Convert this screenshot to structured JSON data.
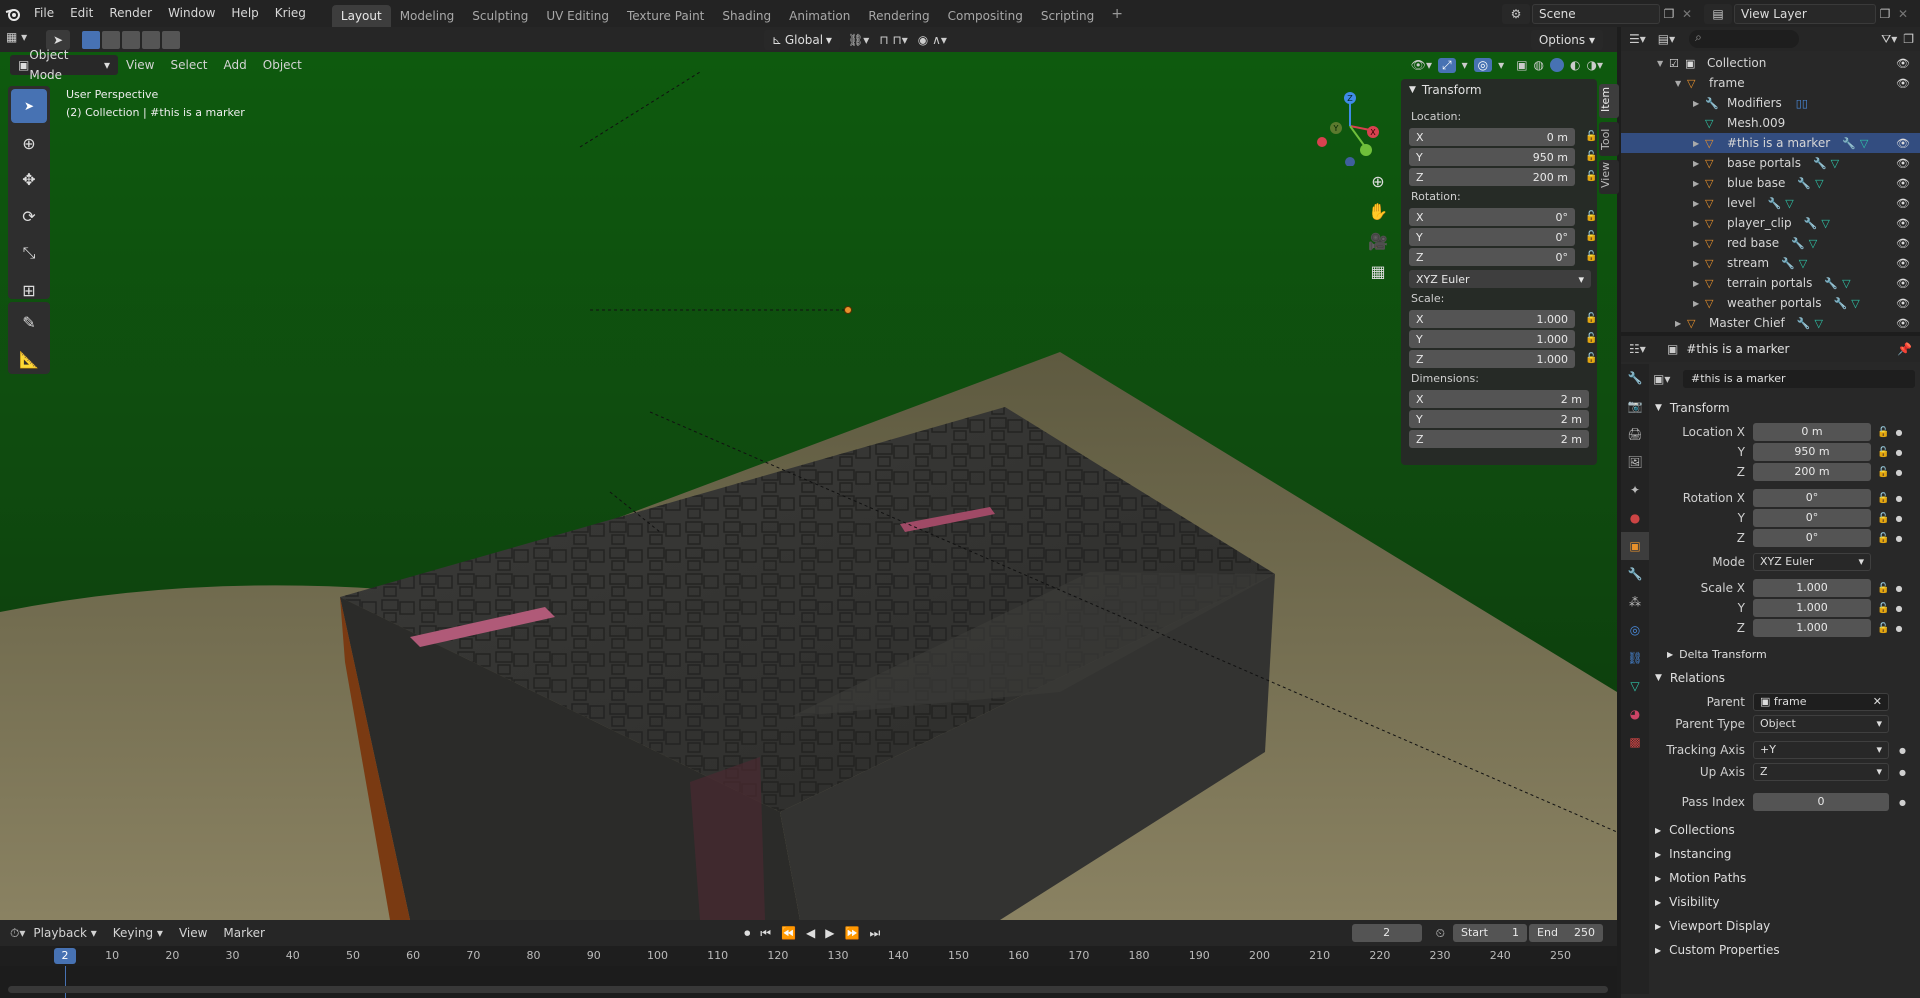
{
  "menu": {
    "items": [
      "File",
      "Edit",
      "Render",
      "Window",
      "Help",
      "Krieg"
    ]
  },
  "workspaces": [
    "Layout",
    "Modeling",
    "Sculpting",
    "UV Editing",
    "Texture Paint",
    "Shading",
    "Animation",
    "Rendering",
    "Compositing",
    "Scripting"
  ],
  "active_workspace": "Layout",
  "scene": {
    "name": "Scene",
    "view_layer": "View Layer"
  },
  "tool_header": {
    "orientation": "Global",
    "options": "Options"
  },
  "viewport_header": {
    "mode": "Object Mode",
    "view": "View",
    "select": "Select",
    "add": "Add",
    "object": "Object"
  },
  "viewport": {
    "perspective": "User Perspective",
    "context": "(2) Collection | #this is a marker"
  },
  "gizmo": {
    "x": "X",
    "y": "Y",
    "z": "Z"
  },
  "npanel": {
    "title": "Transform",
    "location_label": "Location:",
    "location": [
      {
        "axis": "X",
        "value": "0 m"
      },
      {
        "axis": "Y",
        "value": "950 m"
      },
      {
        "axis": "Z",
        "value": "200 m"
      }
    ],
    "rotation_label": "Rotation:",
    "rotation": [
      {
        "axis": "X",
        "value": "0°"
      },
      {
        "axis": "Y",
        "value": "0°"
      },
      {
        "axis": "Z",
        "value": "0°"
      }
    ],
    "rotation_mode": "XYZ Euler",
    "scale_label": "Scale:",
    "scale": [
      {
        "axis": "X",
        "value": "1.000"
      },
      {
        "axis": "Y",
        "value": "1.000"
      },
      {
        "axis": "Z",
        "value": "1.000"
      }
    ],
    "dimensions_label": "Dimensions:",
    "dimensions": [
      {
        "axis": "X",
        "value": "2 m"
      },
      {
        "axis": "Y",
        "value": "2 m"
      },
      {
        "axis": "Z",
        "value": "2 m"
      }
    ],
    "tabs": [
      "Item",
      "Tool",
      "View"
    ]
  },
  "outliner": {
    "items": [
      {
        "label": "Collection",
        "indent": 1,
        "kind": "collection"
      },
      {
        "label": "frame",
        "indent": 2,
        "kind": "object"
      },
      {
        "label": "Modifiers",
        "indent": 3,
        "kind": "modifier"
      },
      {
        "label": "Mesh.009",
        "indent": 3,
        "kind": "mesh"
      },
      {
        "label": "#this is a marker",
        "indent": 3,
        "kind": "object",
        "selected": true
      },
      {
        "label": "base portals",
        "indent": 3,
        "kind": "object"
      },
      {
        "label": "blue base",
        "indent": 3,
        "kind": "object"
      },
      {
        "label": "level",
        "indent": 3,
        "kind": "object"
      },
      {
        "label": "player_clip",
        "indent": 3,
        "kind": "object"
      },
      {
        "label": "red base",
        "indent": 3,
        "kind": "object"
      },
      {
        "label": "stream",
        "indent": 3,
        "kind": "object"
      },
      {
        "label": "terrain portals",
        "indent": 3,
        "kind": "object"
      },
      {
        "label": "weather portals",
        "indent": 3,
        "kind": "object"
      },
      {
        "label": "Master Chief",
        "indent": 2,
        "kind": "object"
      }
    ]
  },
  "properties": {
    "header_object": "#this is a marker",
    "object_name": "#this is a marker",
    "transform_title": "Transform",
    "location": {
      "label_x": "Location X",
      "label_y": "Y",
      "label_z": "Z",
      "x": "0 m",
      "y": "950 m",
      "z": "200 m"
    },
    "rotation": {
      "label_x": "Rotation X",
      "label_y": "Y",
      "label_z": "Z",
      "x": "0°",
      "y": "0°",
      "z": "0°"
    },
    "mode": {
      "label": "Mode",
      "value": "XYZ Euler"
    },
    "scale": {
      "label_x": "Scale X",
      "label_y": "Y",
      "label_z": "Z",
      "x": "1.000",
      "y": "1.000",
      "z": "1.000"
    },
    "delta_transform": "Delta Transform",
    "relations_title": "Relations",
    "parent": {
      "label": "Parent",
      "value": "frame"
    },
    "parent_type": {
      "label": "Parent Type",
      "value": "Object"
    },
    "tracking_axis": {
      "label": "Tracking Axis",
      "value": "+Y"
    },
    "up_axis": {
      "label": "Up Axis",
      "value": "Z"
    },
    "pass_index": {
      "label": "Pass Index",
      "value": "0"
    },
    "sections": [
      "Collections",
      "Instancing",
      "Motion Paths",
      "Visibility",
      "Viewport Display",
      "Custom Properties"
    ]
  },
  "timeline": {
    "playback": "Playback",
    "keying": "Keying",
    "view": "View",
    "marker": "Marker",
    "current_frame": "2",
    "start_label": "Start",
    "start": "1",
    "end_label": "End",
    "end": "250",
    "ticks": [
      "10",
      "20",
      "30",
      "40",
      "50",
      "60",
      "70",
      "80",
      "90",
      "100",
      "110",
      "120",
      "130",
      "140",
      "150",
      "160",
      "170",
      "180",
      "190",
      "200",
      "210",
      "220",
      "230",
      "240",
      "250"
    ]
  },
  "colors": {
    "accent": "#4772b3",
    "selection": "#334d80",
    "background_green": "#0d4d0d",
    "object_orange": "#e8912c",
    "mesh_teal": "#2fc4a8"
  }
}
